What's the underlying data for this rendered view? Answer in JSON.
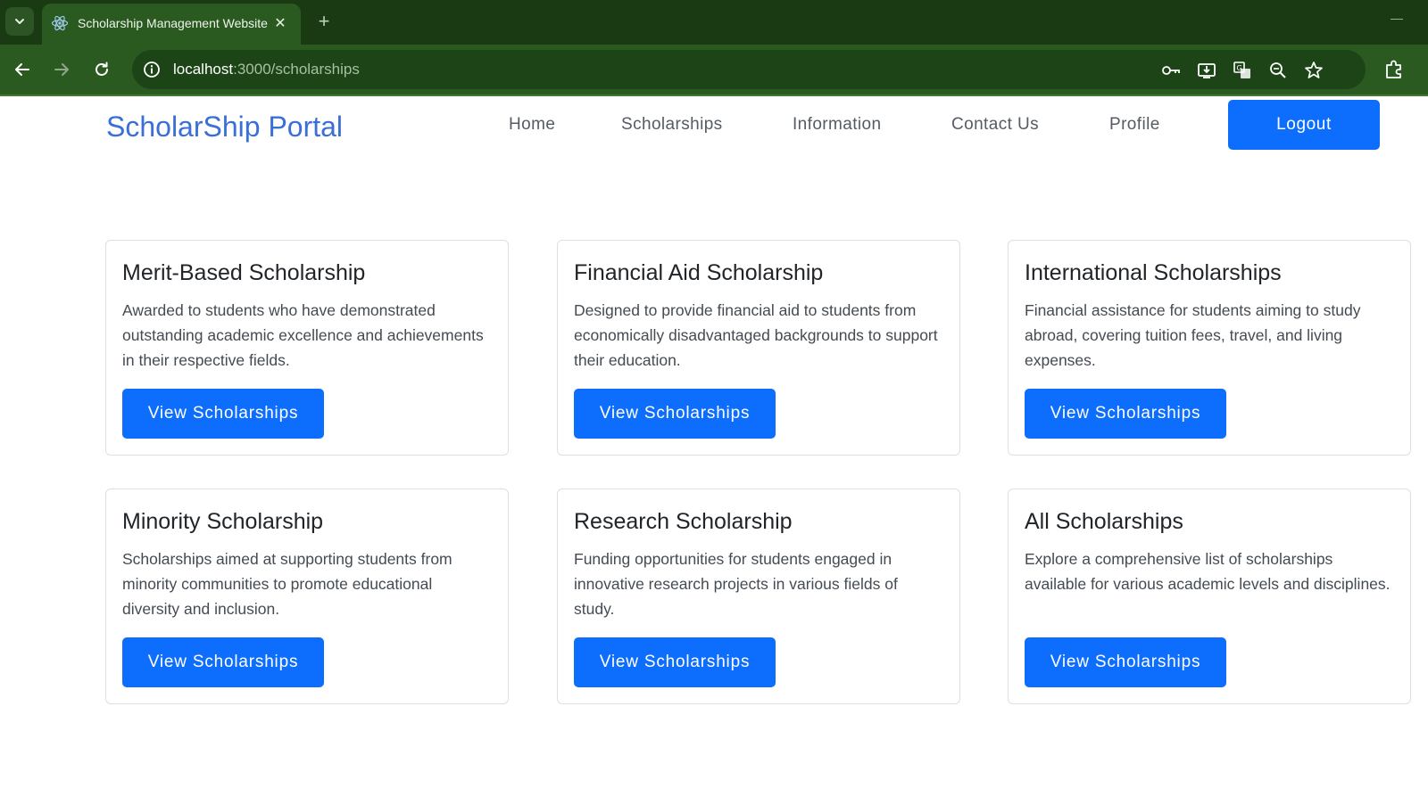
{
  "browser": {
    "tab_title": "Scholarship Management Website",
    "url_host": "localhost",
    "url_path": ":3000/scholarships",
    "icons": {
      "tab_menu": "chevron-down-icon",
      "favicon": "react-icon",
      "tab_close": "close-icon",
      "new_tab": "plus-icon",
      "back": "back-arrow-icon",
      "forward": "forward-arrow-icon",
      "reload": "reload-icon",
      "site_info": "info-icon",
      "password": "key-icon",
      "install": "install-icon",
      "translate": "translate-icon",
      "zoom": "zoom-icon",
      "bookmark": "star-icon",
      "extensions": "puzzle-icon"
    }
  },
  "header": {
    "brand": "ScholarShip Portal",
    "nav": [
      "Home",
      "Scholarships",
      "Information",
      "Contact Us",
      "Profile"
    ],
    "logout_label": "Logout"
  },
  "cards": [
    {
      "title": "Merit-Based Scholarship",
      "text": "Awarded to students who have demonstrated outstanding academic excellence and achievements in their respective fields.",
      "button": "View Scholarships"
    },
    {
      "title": "Financial Aid Scholarship",
      "text": "Designed to provide financial aid to students from economically disadvantaged backgrounds to support their education.",
      "button": "View Scholarships"
    },
    {
      "title": "International Scholarships",
      "text": "Financial assistance for students aiming to study abroad, covering tuition fees, travel, and living expenses.",
      "button": "View Scholarships"
    },
    {
      "title": "Minority Scholarship",
      "text": "Scholarships aimed at supporting students from minority communities to promote educational diversity and inclusion.",
      "button": "View Scholarships"
    },
    {
      "title": "Research Scholarship",
      "text": "Funding opportunities for students engaged in innovative research projects in various fields of study.",
      "button": "View Scholarships"
    },
    {
      "title": "All Scholarships",
      "text": "Explore a comprehensive list of scholarships available for various academic levels and disciplines.",
      "button": "View Scholarships"
    }
  ],
  "colors": {
    "primary": "#0d6efd",
    "brand": "#3a6fd8",
    "chrome_dark": "#1a3a14",
    "chrome": "#2a5a20"
  }
}
